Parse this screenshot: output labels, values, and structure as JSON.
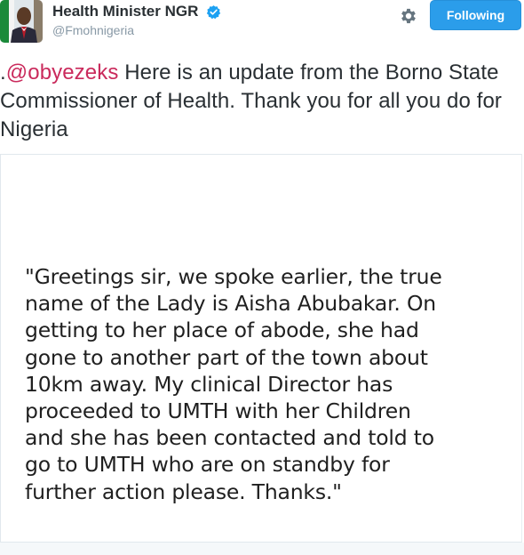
{
  "header": {
    "display_name": "Health Minister NGR",
    "handle": "@Fmohnigeria",
    "follow_label": "Following",
    "verified_icon": "verified-badge-icon",
    "settings_icon": "gear-icon"
  },
  "tweet": {
    "prefix": ".",
    "mention": "@obyezeks",
    "text": " Here is an update from the Borno State Commissioner of Health. Thank you for all you do for Nigeria"
  },
  "media": {
    "quote": "\"Greetings sir, we spoke earlier, the true\nname of the Lady is Aisha Abubakar. On\ngetting to her place of abode, she had\ngone to another part of the town about\n10km away. My clinical Director has\nproceeded to UMTH with her Children\nand she has been contacted and told to\ngo to UMTH who are on standby for\nfurther action please. Thanks.\""
  },
  "colors": {
    "accent": "#2b9dea",
    "mention": "#ca2a5c",
    "text": "#292f33",
    "muted": "#8899a6"
  }
}
